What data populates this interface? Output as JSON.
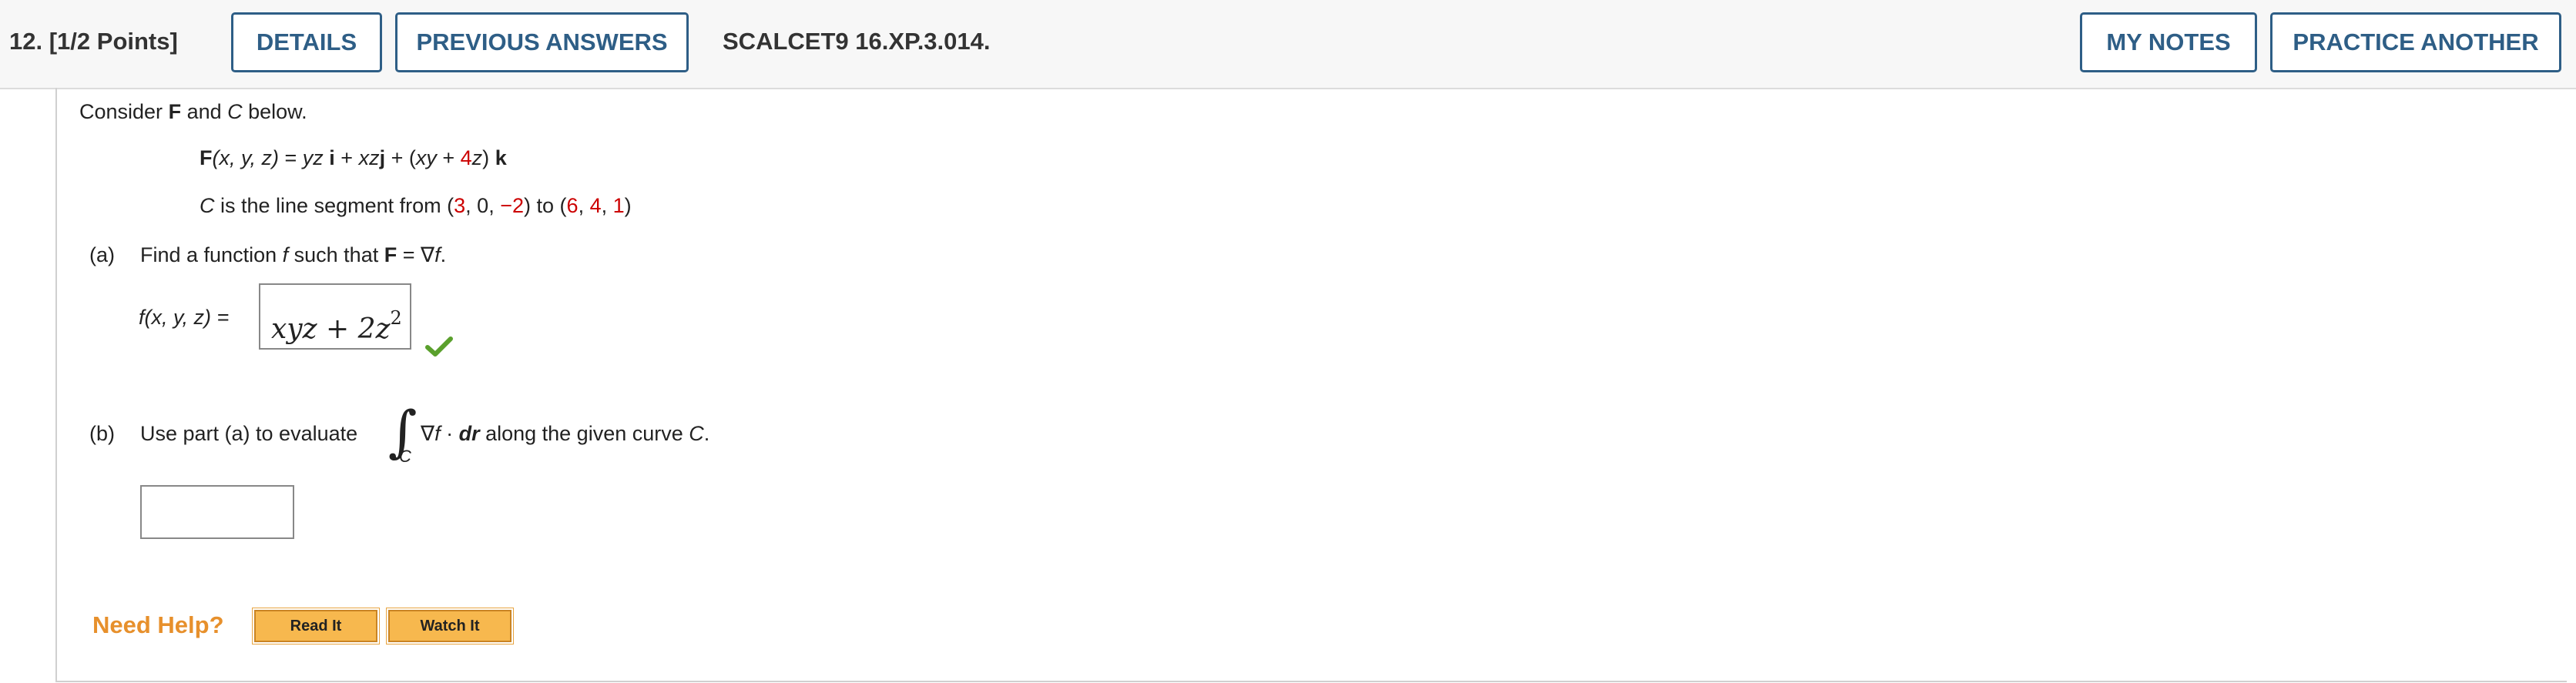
{
  "header": {
    "question_number": "12.",
    "points": "[1/2 Points]",
    "details_label": "DETAILS",
    "previous_answers_label": "PREVIOUS ANSWERS",
    "question_id": "SCALCET9 16.XP.3.014.",
    "my_notes_label": "MY NOTES",
    "practice_another_label": "PRACTICE ANOTHER"
  },
  "problem": {
    "intro_1": "Consider ",
    "intro_F": "F",
    "intro_2": " and ",
    "intro_C": "C",
    "intro_3": " below.",
    "field": {
      "F": "F",
      "args": "(x, y, z)",
      "eq": " = ",
      "t1": "yz",
      "i": "i",
      "plus1": " + ",
      "t2": "xz",
      "j": "j",
      "plus2": " + (",
      "t3": "xy",
      "plus3": " + ",
      "coef": "4",
      "z": "z",
      "close": ")",
      "k": "k"
    },
    "curve": {
      "C": "C",
      "text": " is the line segment from (",
      "p1x": "3",
      "p1y": "0",
      "p1z": "−2",
      "mid": ") to (",
      "p2x": "6",
      "p2y": "4",
      "p2z": "1",
      "end": ")",
      "comma": ", "
    }
  },
  "part_a": {
    "label": "(a)",
    "text_1": "Find a function ",
    "f": "f",
    "text_2": " such that ",
    "F": "F",
    "text_3": " = ∇",
    "f2": "f",
    "text_4": ".",
    "lhs": "f(x, y, z) =",
    "answer_main": "xyz + 2z",
    "answer_exp": "2",
    "status": "correct",
    "check_color": "#5aa02c"
  },
  "part_b": {
    "label": "(b)",
    "text_1": "Use part (a) to evaluate",
    "integral_sub": "C",
    "grad": "∇",
    "f": "f",
    "dot": " · ",
    "dr": "dr",
    "text_2": " along the given curve ",
    "C": "C",
    "text_3": ".",
    "answer_value": ""
  },
  "help": {
    "label": "Need Help?",
    "read_it": "Read It",
    "watch_it": "Watch It"
  }
}
